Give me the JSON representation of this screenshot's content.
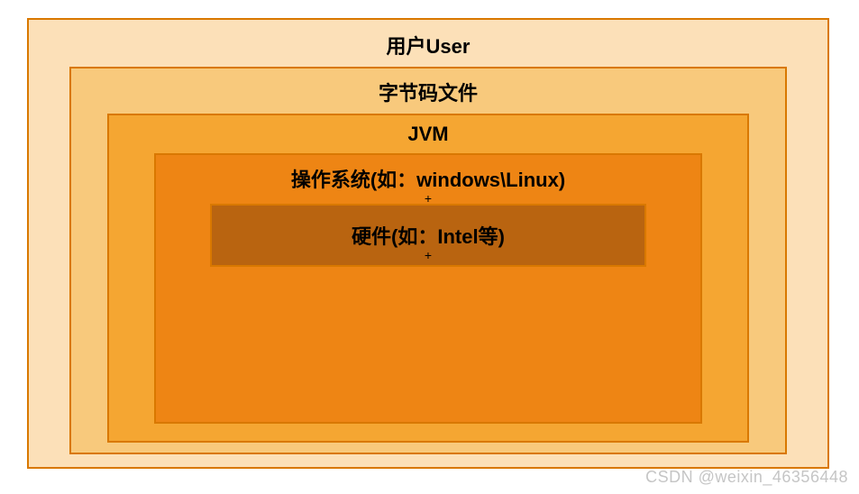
{
  "layers": {
    "user": "用户User",
    "bytecode": "字节码文件",
    "jvm": "JVM",
    "os": "操作系统(如：windows\\Linux)",
    "hardware": "硬件(如：Intel等)"
  },
  "watermark": "CSDN @weixin_46356448"
}
